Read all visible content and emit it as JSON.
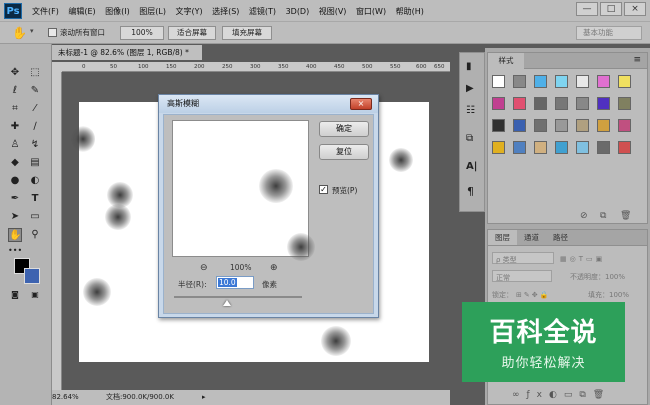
{
  "menu": {
    "logo": "Ps",
    "items": [
      "文件(F)",
      "编辑(E)",
      "图像(I)",
      "图层(L)",
      "文字(Y)",
      "选择(S)",
      "滤镜(T)",
      "3D(D)",
      "视图(V)",
      "窗口(W)",
      "帮助(H)"
    ],
    "window_controls": [
      "—",
      "□",
      "×"
    ]
  },
  "options_bar": {
    "scroll_all_label": "滚动所有窗口",
    "zoom_value": "100%",
    "fit_screen": "适合屏幕",
    "fill_screen": "填充屏幕",
    "workspace": "基本功能"
  },
  "document": {
    "tab_title": "未标题-1 @ 82.6% (图层 1, RGB/8) *",
    "ruler_ticks": [
      "0",
      "50",
      "100",
      "150",
      "200",
      "250",
      "300",
      "350",
      "400",
      "450",
      "500",
      "550",
      "600",
      "650"
    ],
    "status_zoom": "82.64%",
    "status_doc": "文档:900.0K/900.0K"
  },
  "swatches_panel": {
    "tab": "样式",
    "colors": [
      [
        "#ffffff",
        "#888888",
        "#4fb0e8",
        "#7fd4f0",
        "#e8e8e8",
        "#e070d0",
        "#f0e060"
      ],
      [
        "#c04090",
        "#e05070",
        "#666666",
        "#777777",
        "#888888",
        "#5030c0",
        "#808060"
      ],
      [
        "#303030",
        "#3a60b0",
        "#707070",
        "#999999",
        "#b0a080",
        "#d0a040",
        "#c05080"
      ],
      [
        "#e0b020",
        "#5080c0",
        "#d0b080",
        "#40a0d0",
        "#80c0e0",
        "#6a6a6a",
        "#d05050"
      ]
    ]
  },
  "layers_panel": {
    "tabs": [
      "图层",
      "通道",
      "路径"
    ],
    "filter_label": "ρ 类型",
    "blend_mode": "正常",
    "opacity_label": "不透明度：100%",
    "lock_label": "锁定：",
    "fill_label": "填充：100%"
  },
  "dialog": {
    "title": "高斯模糊",
    "close": "×",
    "ok": "确定",
    "reset": "复位",
    "preview_label": "预览(P)",
    "preview_checked": "✓",
    "zoom_minus": "⊖",
    "zoom_value": "100%",
    "zoom_plus": "⊕",
    "radius_label": "半径(R):",
    "radius_value": "10.0",
    "unit": "像素"
  },
  "watermark": {
    "title": "百科全说",
    "subtitle": "助你轻松解决"
  }
}
